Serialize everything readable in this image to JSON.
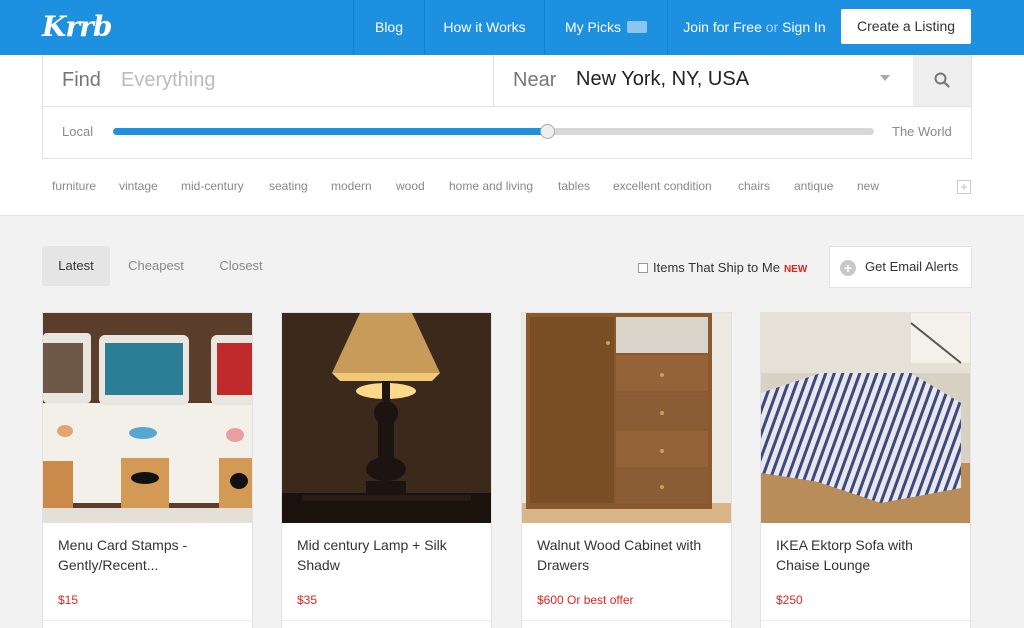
{
  "header": {
    "logo": "Krrb",
    "nav": {
      "blog": "Blog",
      "how_it_works": "How it Works",
      "my_picks": "My Picks",
      "join": "Join for Free",
      "or": "or",
      "sign_in": "Sign In"
    },
    "create_listing": "Create a Listing"
  },
  "search": {
    "find_label": "Find",
    "find_placeholder": "Everything",
    "near_label": "Near",
    "near_value": "New York, NY, USA",
    "range_local": "Local",
    "range_world": "The World",
    "range_level": 0.57
  },
  "tags": [
    "furniture",
    "vintage",
    "mid-century",
    "seating",
    "modern",
    "wood",
    "home and living",
    "tables",
    "excellent condition",
    "chairs",
    "antique",
    "new"
  ],
  "sort": {
    "latest": "Latest",
    "cheapest": "Cheapest",
    "closest": "Closest",
    "active": "latest"
  },
  "ship": {
    "label": "Items That Ship to Me",
    "badge": "NEW"
  },
  "email_alerts": "Get Email Alerts",
  "listings": [
    {
      "title": "Menu Card Stamps - Gently/Recent...",
      "price": "$15"
    },
    {
      "title": "Mid century Lamp + Silk Shadw",
      "price": "$35"
    },
    {
      "title": "Walnut Wood Cabinet with Drawers",
      "price": "$600 Or best offer"
    },
    {
      "title": "IKEA Ektorp Sofa with Chaise Lounge",
      "price": "$250"
    }
  ],
  "colors": {
    "brand_blue": "#1e90e0",
    "price_red": "#e0261e"
  }
}
